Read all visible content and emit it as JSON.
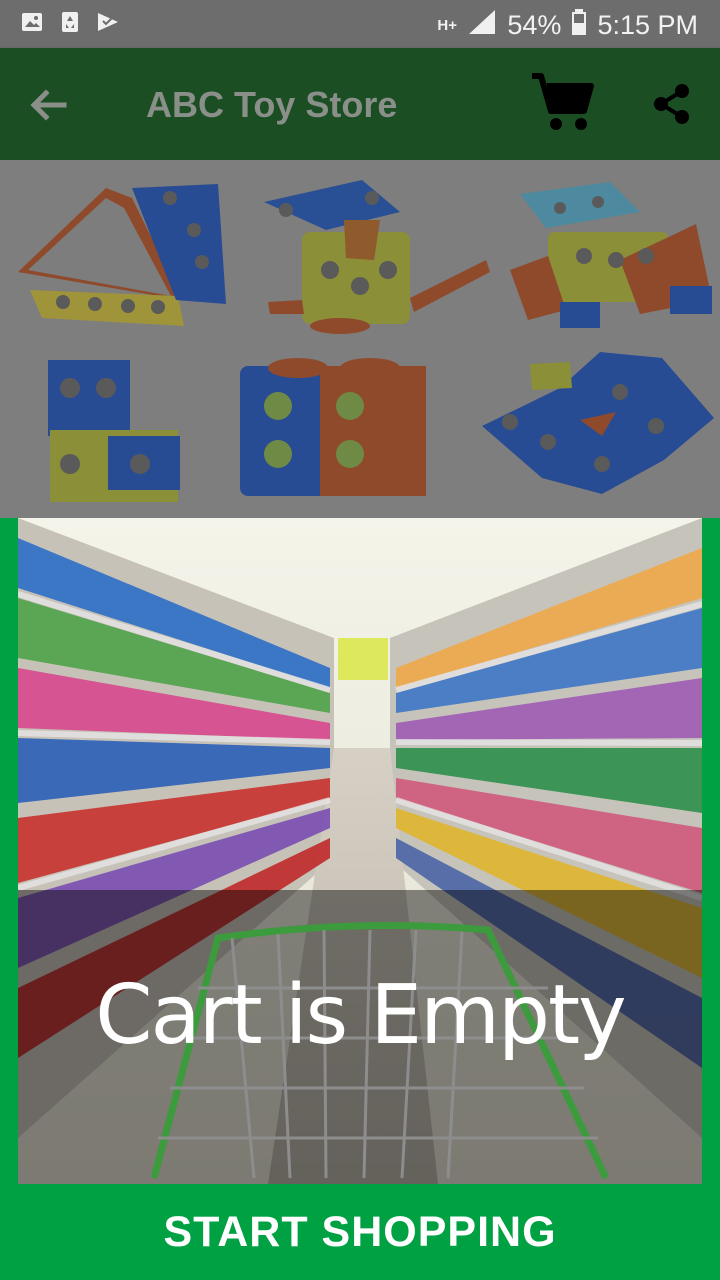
{
  "status_bar": {
    "network": "H+",
    "battery": "54%",
    "time": "5:15 PM",
    "icons": [
      "gallery-icon",
      "recycle-icon",
      "task-icon",
      "signal-icon",
      "battery-icon"
    ]
  },
  "app_bar": {
    "title": "ABC Toy Store",
    "background": "#1b4f23",
    "icons": [
      "back-arrow-icon",
      "cart-icon",
      "share-icon"
    ]
  },
  "banner": {
    "description_icons": [
      "toy-model-triangle",
      "toy-model-mouse",
      "toy-model-dog",
      "toy-model-l-shape",
      "toy-model-box",
      "toy-model-star"
    ]
  },
  "empty_state": {
    "message": "Cart is Empty",
    "accent": "#00a143"
  },
  "action": {
    "start_label": "START SHOPPING"
  }
}
